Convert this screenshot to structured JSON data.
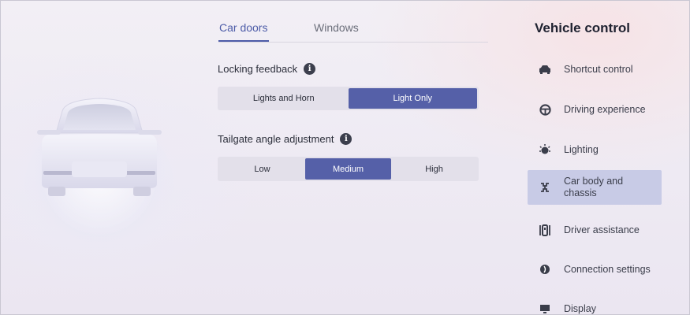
{
  "tabs": [
    {
      "label": "Car doors",
      "active": true
    },
    {
      "label": "Windows",
      "active": false
    }
  ],
  "locking": {
    "label": "Locking feedback",
    "info_icon": "i",
    "options": [
      "Lights and Horn",
      "Light Only"
    ],
    "selected": "Light Only"
  },
  "tailgate": {
    "label": "Tailgate angle adjustment",
    "info_icon": "i",
    "options": [
      "Low",
      "Medium",
      "High"
    ],
    "selected": "Medium"
  },
  "panel": {
    "title": "Vehicle control",
    "items": [
      {
        "label": "Shortcut control",
        "icon": "car-icon"
      },
      {
        "label": "Driving experience",
        "icon": "steering-wheel-icon"
      },
      {
        "label": "Lighting",
        "icon": "light-icon"
      },
      {
        "label": "Car body and chassis",
        "icon": "chassis-icon",
        "selected": true
      },
      {
        "label": "Driver assistance",
        "icon": "driver-assist-icon"
      },
      {
        "label": "Connection settings",
        "icon": "connection-icon"
      },
      {
        "label": "Display",
        "icon": "display-icon"
      }
    ]
  },
  "colors": {
    "accent": "#5560a8",
    "tab_active": "#4d5ca8",
    "menu_selected": "#c8cbe6"
  }
}
